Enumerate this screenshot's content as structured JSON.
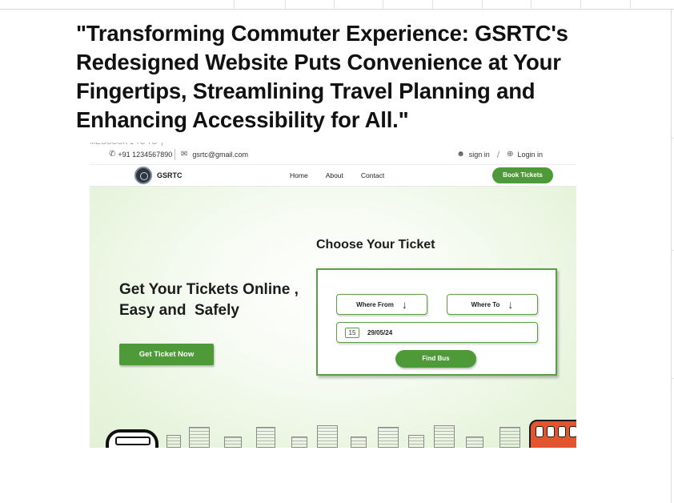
{
  "headline": "\"Transforming Commuter Experience: GSRTC's Redesigned Website Puts Convenience at Your Fingertips, Streamlining Travel Planning and Enhancing Accessibility for All.\"",
  "site": {
    "topbar": {
      "phone": "+91 1234567890",
      "email": "gsrtc@gmail.com",
      "sign_in": "sign in",
      "login": "Login in"
    },
    "nav": {
      "brand": "GSRTC",
      "links": [
        "Home",
        "About",
        "Contact"
      ],
      "book_button": "Book Tickets"
    },
    "hero": {
      "title_line1": "Get Your Tickets Online ,",
      "title_line2": "Easy and  Safely",
      "cta_button": "Get Ticket Now"
    },
    "ticket_form": {
      "title": "Choose Your Ticket",
      "from_label": "Where From",
      "to_label": "Where To",
      "calendar_day": "15",
      "date_value": "29/05/24",
      "find_button": "Find Bus"
    }
  },
  "colors": {
    "accent_green": "#4e9a38",
    "bus_red": "#e2552f"
  },
  "icons": [
    "phone-icon",
    "mail-icon",
    "user-icon",
    "login-icon",
    "logo-icon",
    "arrow-down-icon",
    "calendar-icon",
    "building-icon",
    "bus-icon"
  ]
}
